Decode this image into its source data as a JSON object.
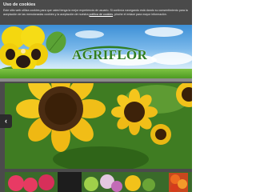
{
  "cookie_notice": {
    "title": "Uso de cookies",
    "text": "Este sitio web utiliza cookies para que usted tenga la mejor experiencia de usuario. Si continúa navegando está dando su consentimiento para la aceptación de las mencionadas cookies y la aceptación de nuestra",
    "link_label": "política de cookies",
    "text_end": ", pinche el enlace para mayor información."
  },
  "header": {
    "logo_text": "AGRIFLOR"
  },
  "slider": {
    "prev_icon": "chevron-left-icon",
    "prev_glyph": "‹"
  },
  "colors": {
    "cookie_bg": "#4a4a4a",
    "logo_green": "#2f7d22",
    "page_dark": "#4b4b4b"
  }
}
